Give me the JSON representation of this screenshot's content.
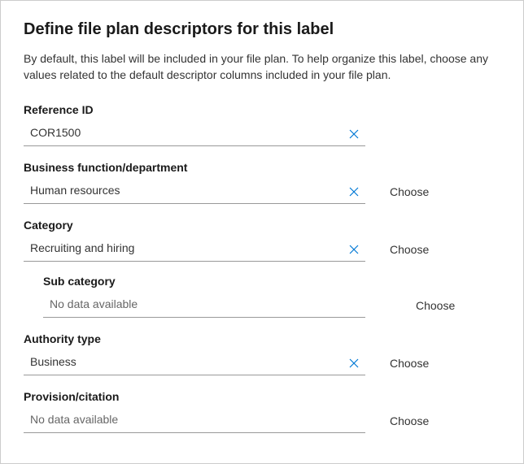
{
  "header": {
    "title": "Define file plan descriptors for this label",
    "description": "By default, this label will be included in your file plan. To help organize this label, choose any values related to the default descriptor columns included in your file plan."
  },
  "fields": {
    "referenceId": {
      "label": "Reference ID",
      "value": "COR1500"
    },
    "businessFunction": {
      "label": "Business function/department",
      "value": "Human resources",
      "chooseLabel": "Choose"
    },
    "category": {
      "label": "Category",
      "value": "Recruiting and hiring",
      "chooseLabel": "Choose"
    },
    "subCategory": {
      "label": "Sub category",
      "placeholder": "No data available",
      "chooseLabel": "Choose"
    },
    "authorityType": {
      "label": "Authority type",
      "value": "Business",
      "chooseLabel": "Choose"
    },
    "provisionCitation": {
      "label": "Provision/citation",
      "placeholder": "No data available",
      "chooseLabel": "Choose"
    }
  }
}
